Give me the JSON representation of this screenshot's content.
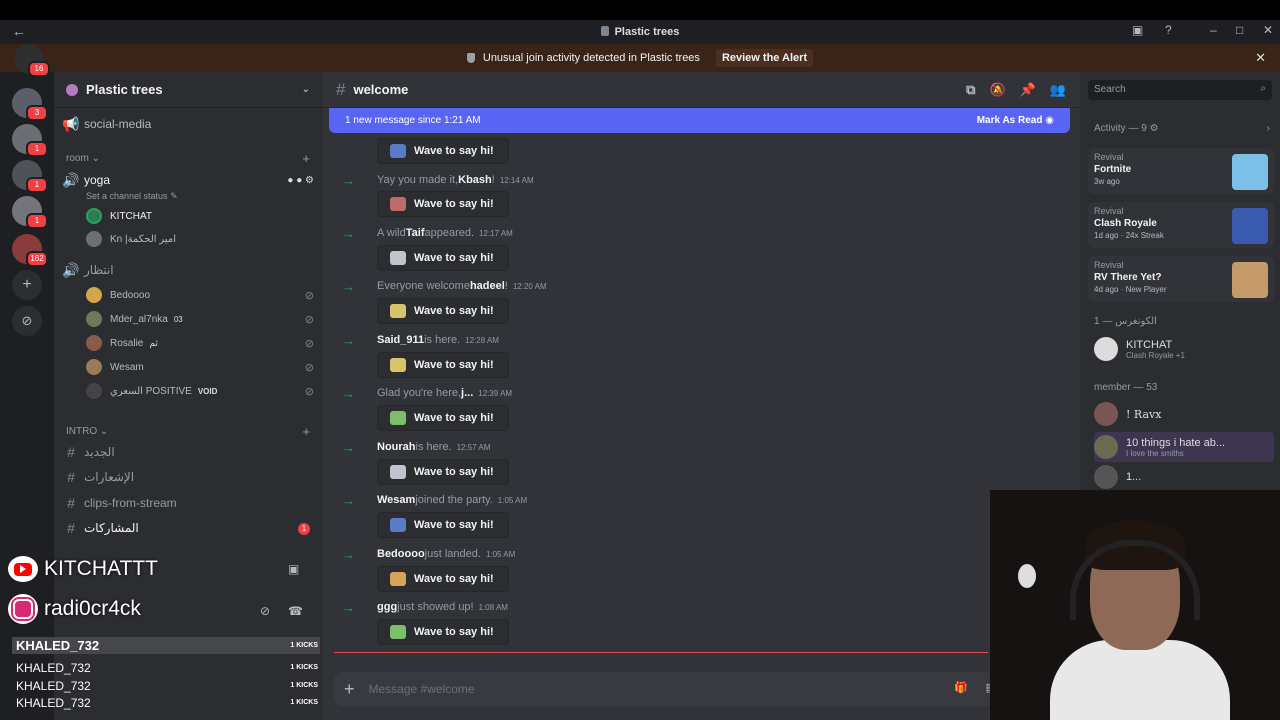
{
  "window": {
    "title": "Plastic trees"
  },
  "alert": {
    "text": "Unusual join activity detected in Plastic trees",
    "action": "Review the Alert"
  },
  "guilds": [
    {
      "badge": "16"
    },
    {
      "badge": "3"
    },
    {
      "badge": "1"
    },
    {
      "badge": "1"
    },
    {
      "badge": "1"
    },
    {
      "badge": "162"
    }
  ],
  "sidebar": {
    "server_name": "Plastic trees",
    "social": "social-media",
    "cat_room": "room",
    "voice_yoga": "yoga",
    "yoga_status": "Set a channel status",
    "yoga_users": [
      "KITCHAT",
      "Kn |امير الحكمة"
    ],
    "voice_wait": "انتظار",
    "wait_users": [
      "Bedoooo",
      "Mder_al7nka",
      "Rosalie",
      "Wesam",
      "السعري POSITIVE"
    ],
    "wait_tags": {
      "mder": "03",
      "rosalie": "ثم",
      "positive": "VOID"
    },
    "cat_intro": "INTRO",
    "intro_channels": [
      "الجديد",
      "الإشعارات",
      "clips-from-stream",
      "المشاركات"
    ],
    "mentions_badge": "1"
  },
  "overlay": {
    "youtube": "KITCHATTT",
    "instagram": "radi0cr4ck",
    "kicks": [
      {
        "name": "KHALED_732",
        "count": "1 KICKS"
      },
      {
        "name": "KHALED_732",
        "count": "1 KICKS"
      },
      {
        "name": "KHALED_732",
        "count": "1 KICKS"
      },
      {
        "name": "KHALED_732",
        "count": "1 KICKS"
      }
    ]
  },
  "channel": {
    "name": "welcome",
    "new_banner": "1 new message since 1:21 AM",
    "mark_read": "Mark As Read",
    "composer_placeholder": "Message #welcome",
    "wave_label": "Wave to say hi!"
  },
  "messages": [
    {
      "pre": "Yay you made it, ",
      "name": "Kbash",
      "post": "!",
      "time": "12:14 AM"
    },
    {
      "pre": "A wild ",
      "name": "Taif",
      "post": " appeared.",
      "time": "12:17 AM"
    },
    {
      "pre": "Everyone welcome ",
      "name": "hadeel",
      "post": "!",
      "time": "12:20 AM"
    },
    {
      "pre": "",
      "name": "Said_911",
      "post": " is here.",
      "time": "12:28 AM"
    },
    {
      "pre": "Glad you're here, ",
      "name": "j...",
      "post": "",
      "time": "12:39 AM"
    },
    {
      "pre": "",
      "name": "Nourah",
      "post": " is here.",
      "time": "12:57 AM"
    },
    {
      "pre": "",
      "name": "Wesam",
      "post": " joined the party.",
      "time": "1:05 AM"
    },
    {
      "pre": "",
      "name": "Bedoooo",
      "post": " just landed.",
      "time": "1:05 AM"
    },
    {
      "pre": "",
      "name": "ggg",
      "post": " just showed up!",
      "time": "1:08 AM"
    }
  ],
  "right": {
    "search_placeholder": "Search",
    "activity_header": "Activity — 9",
    "cards": [
      {
        "group": "Revival",
        "game": "Fortnite",
        "meta": "3w ago"
      },
      {
        "group": "Revival",
        "game": "Clash Royale",
        "meta": "1d ago · 24x Streak"
      },
      {
        "group": "Revival",
        "game": "RV There Yet?",
        "meta": "4d ago · New Player"
      }
    ],
    "role1": "الكونغرس — 1",
    "owner": {
      "name": "KITCHAT",
      "sub": "Clash Royale +1"
    },
    "members_header": "member — 53",
    "members": [
      {
        "name": "! Ravx",
        "sub": ""
      },
      {
        "name": "10 things i hate ab...",
        "sub": "I love the smiths"
      },
      {
        "name": "1...",
        "sub": ""
      }
    ]
  }
}
